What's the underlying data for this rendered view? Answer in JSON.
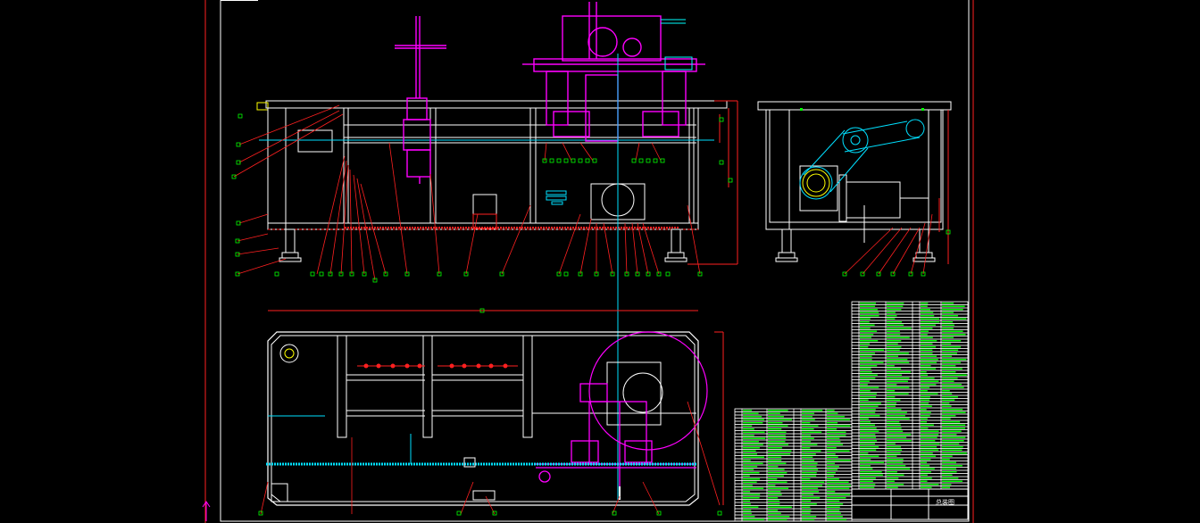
{
  "window": {
    "title": ""
  },
  "colors": {
    "background": "#000000",
    "frame": "#ffffff",
    "border": "#ff2020",
    "machine": "#ffffff",
    "mechanism": "#ff00ff",
    "centerline": "#00e0ff",
    "leader": "#ff2020",
    "balloon": "#00ff00",
    "table_line": "#ffffff",
    "table_text": "#00ff00",
    "ucs": "#ff00ff"
  },
  "icons": {
    "ucs": "ucs-axis-icon"
  },
  "title_block": {
    "drawing_label": "总装图"
  }
}
